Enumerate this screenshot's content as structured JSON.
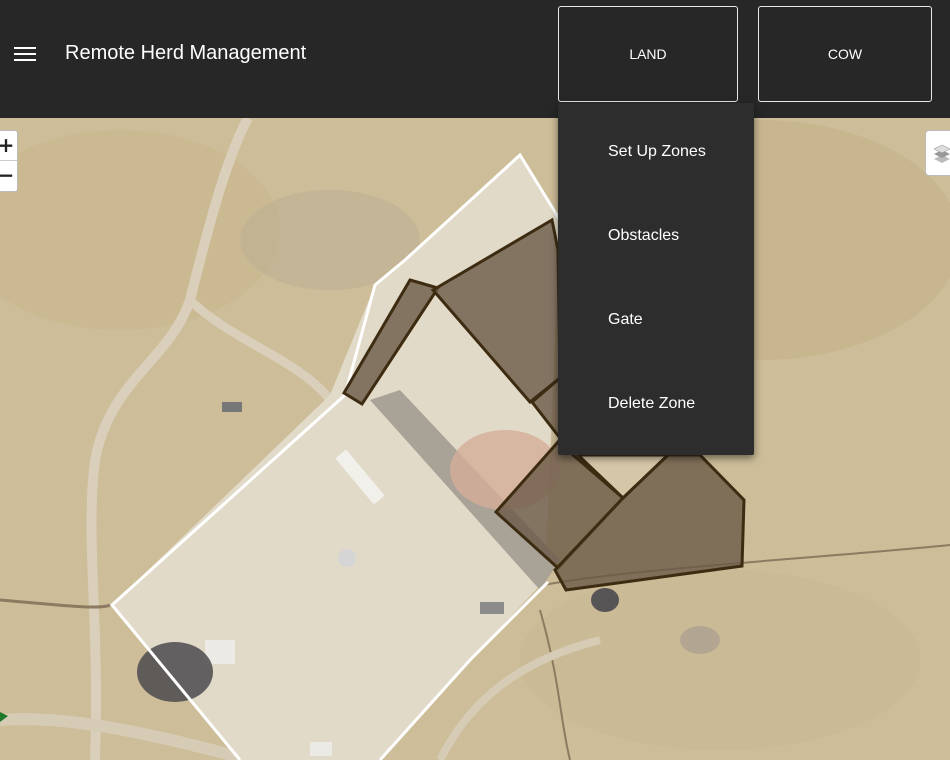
{
  "header": {
    "title": "Remote Herd Management",
    "menu_icon": "hamburger-menu-icon",
    "land_label": "LAND",
    "cow_label": "COW"
  },
  "land_menu": {
    "items": [
      "Set Up Zones",
      "Obstacles",
      "Gate",
      "Delete Zone"
    ]
  },
  "map_controls": {
    "zoom_in": "+",
    "zoom_out": "−",
    "layers_icon": "layers-icon"
  },
  "colors": {
    "header_bg": "#272727",
    "dropdown_bg": "#2d2d2d",
    "zone_fill": "#6b5a48",
    "zone_stroke": "#3d2c12",
    "boundary": "#ffffff"
  }
}
